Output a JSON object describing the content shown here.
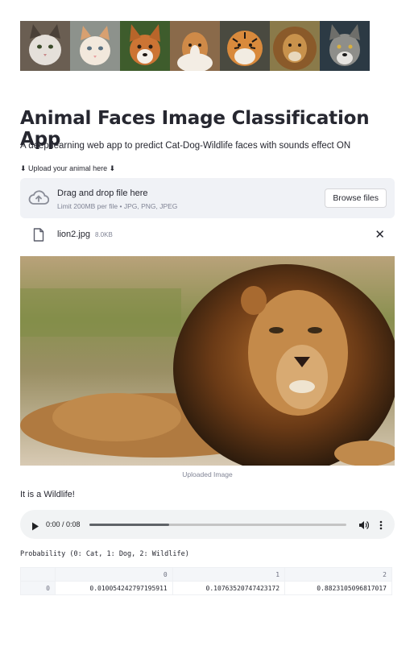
{
  "banner": {
    "tiles": [
      {
        "animal": "cat",
        "colors": [
          "#5a5046",
          "#e8e4df"
        ]
      },
      {
        "animal": "cat",
        "colors": [
          "#8a8f8a",
          "#efe3d4"
        ]
      },
      {
        "animal": "dog",
        "colors": [
          "#3d5a2a",
          "#c8702e"
        ]
      },
      {
        "animal": "dog",
        "colors": [
          "#8a5a32",
          "#d48a4a"
        ]
      },
      {
        "animal": "tiger",
        "colors": [
          "#4a4a40",
          "#d88a3a"
        ]
      },
      {
        "animal": "lion",
        "colors": [
          "#7a6a40",
          "#b8843e"
        ]
      },
      {
        "animal": "wolf",
        "colors": [
          "#2c3a44",
          "#9a9a98"
        ]
      }
    ]
  },
  "header": {
    "title": "Animal Faces Image Classification App",
    "subtitle": "A deep learning web app to predict Cat-Dog-Wildlife faces with sounds effect ON"
  },
  "uploader": {
    "label": "⬇ Upload your animal here ⬇",
    "drop_title": "Drag and drop file here",
    "limit_text": "Limit 200MB per file • JPG, PNG, JPEG",
    "browse_label": "Browse files",
    "file_name": "lion2.jpg",
    "file_size": "8.0KB",
    "close_glyph": "✕"
  },
  "image": {
    "caption": "Uploaded Image"
  },
  "result": {
    "text": "It is a Wildlife!"
  },
  "audio": {
    "time": "0:00 / 0:08",
    "progress": 0.31
  },
  "probability": {
    "label": "Probability (0: Cat, 1: Dog, 2: Wildlife)",
    "columns": [
      "0",
      "1",
      "2"
    ],
    "rows": [
      {
        "index": "0",
        "values": [
          "0.010054242797195911",
          "0.10763520747423172",
          "0.8823105096817017"
        ]
      }
    ]
  },
  "colors": {
    "accent": "#262730",
    "secondary_bg": "#f0f2f6",
    "muted_text": "#808495"
  }
}
